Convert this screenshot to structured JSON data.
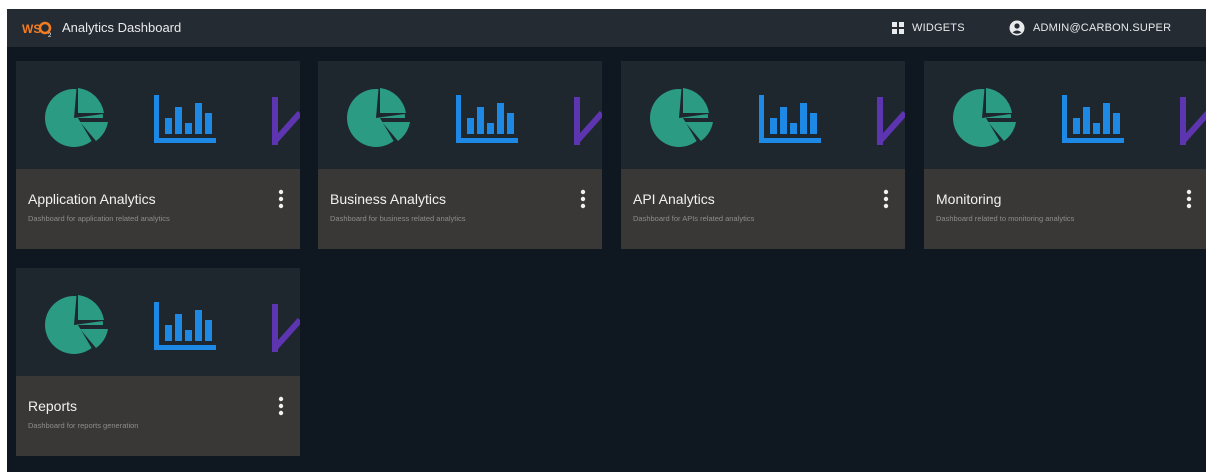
{
  "header": {
    "title": "Analytics Dashboard",
    "logo_icon": "wso2-logo",
    "widgets_label": "WIDGETS",
    "widgets_icon": "grid-icon",
    "user_label": "ADMIN@CARBON.SUPER",
    "user_icon": "account-circle-icon"
  },
  "colors": {
    "topbar": "#242b32",
    "background": "#0f1820",
    "card_top": "#1f272e",
    "card_footer": "#3a3837",
    "pie": "#2b9b83",
    "bar": "#1e88e5",
    "line": "#5e35b1",
    "logo_orange": "#f47b20"
  },
  "dashboards": [
    {
      "title": "Application Analytics",
      "description": "Dashboard for application related analytics",
      "thumb_icons": [
        "pie-chart-icon",
        "bar-chart-icon",
        "line-chart-icon"
      ]
    },
    {
      "title": "Business Analytics",
      "description": "Dashboard for business related analytics",
      "thumb_icons": [
        "pie-chart-icon",
        "bar-chart-icon",
        "line-chart-icon"
      ]
    },
    {
      "title": "API Analytics",
      "description": "Dashboard for APIs related analytics",
      "thumb_icons": [
        "pie-chart-icon",
        "bar-chart-icon",
        "line-chart-icon"
      ]
    },
    {
      "title": "Monitoring",
      "description": "Dashboard related to monitoring analytics",
      "thumb_icons": [
        "pie-chart-icon",
        "bar-chart-icon",
        "line-chart-icon"
      ]
    },
    {
      "title": "Reports",
      "description": "Dashboard for reports generation",
      "thumb_icons": [
        "pie-chart-icon",
        "bar-chart-icon",
        "line-chart-icon"
      ]
    }
  ],
  "card_menu_icon": "more-vertical-icon"
}
